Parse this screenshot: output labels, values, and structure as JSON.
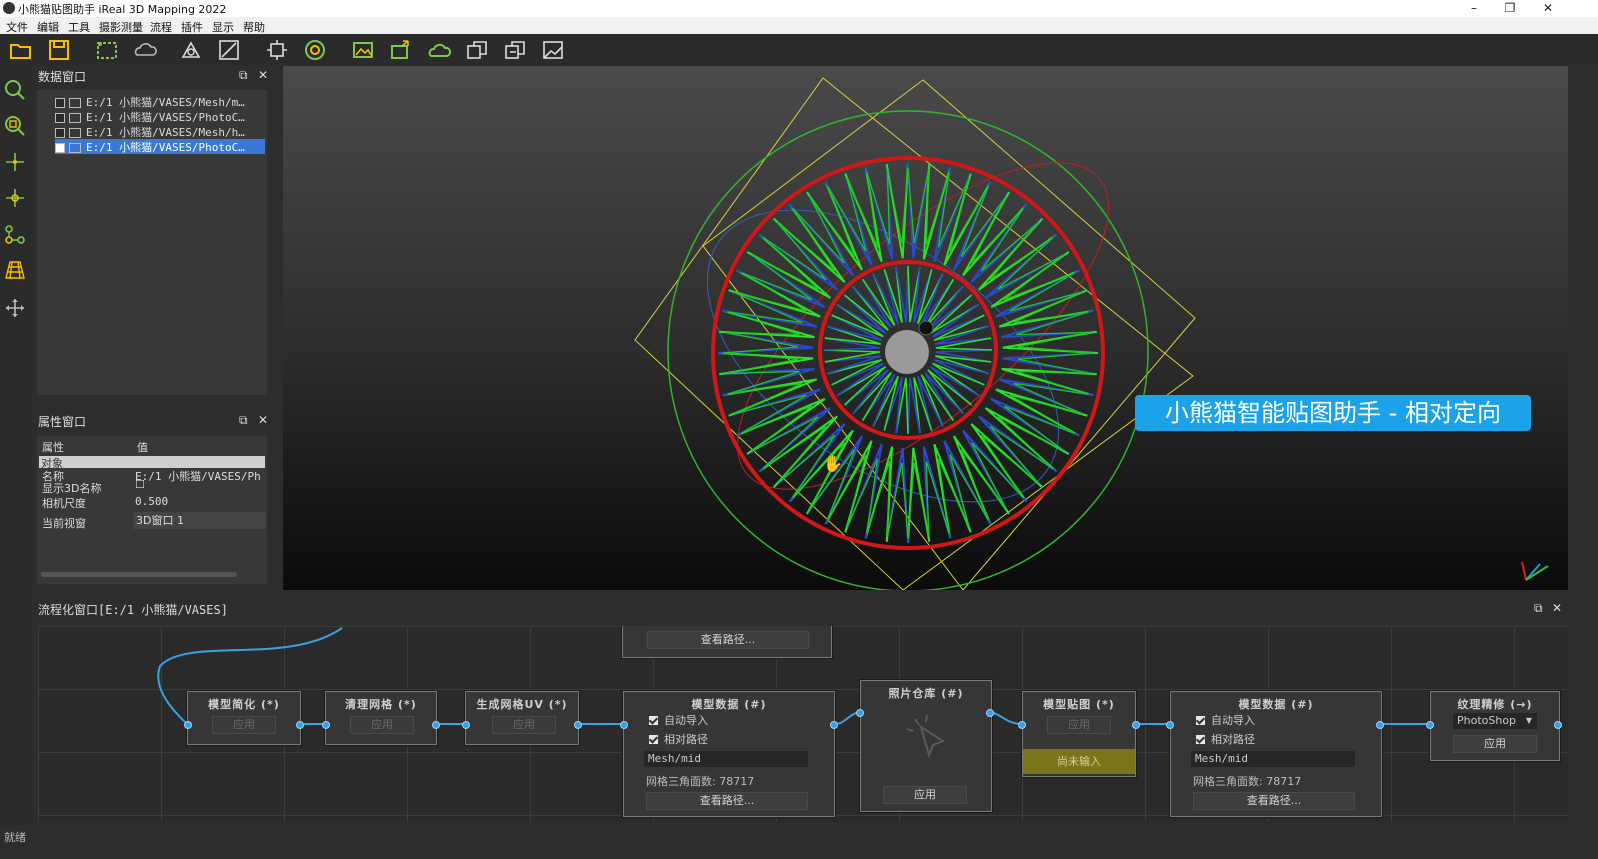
{
  "window": {
    "title": "小熊猫贴图助手 iReal 3D Mapping 2022",
    "minimize": "–",
    "restore": "❐",
    "close": "✕"
  },
  "menu": [
    "文件",
    "编辑",
    "工具",
    "摄影测量",
    "流程",
    "插件",
    "显示",
    "帮助"
  ],
  "toolbar_icons": [
    "open-folder-icon",
    "save-icon",
    "select-region-icon",
    "sdr-cloud-icon",
    "measure-icon",
    "edit-mesh-icon",
    "bbox-icon",
    "target-icon",
    "photo-align-icon",
    "camera-export-icon",
    "cloud-icon",
    "texture-a-icon",
    "texture-b-icon",
    "view-icon"
  ],
  "data_panel": {
    "title": "数据窗口",
    "float": "⧉",
    "close": "✕",
    "items": [
      {
        "label": "E:/1 小熊猫/VASES/Mesh/m…",
        "checked": false,
        "type": "mesh"
      },
      {
        "label": "E:/1 小熊猫/VASES/PhotoC…",
        "checked": false,
        "type": "folder"
      },
      {
        "label": "E:/1 小熊猫/VASES/Mesh/h…",
        "checked": false,
        "type": "mesh"
      },
      {
        "label": "E:/1 小熊猫/VASES/PhotoC…",
        "checked": true,
        "type": "folder",
        "selected": true
      }
    ]
  },
  "prop_panel": {
    "title": "属性窗口",
    "float": "⧉",
    "close": "✕",
    "col_attr": "属性",
    "col_value": "值",
    "section": "对象",
    "rows": [
      {
        "label": "名称",
        "value": "E:/1 小熊猫/VASES/Ph"
      },
      {
        "label": "显示3D名称",
        "value": "☐"
      },
      {
        "label": "相机尺度",
        "value": "0.500"
      },
      {
        "label": "当前视窗",
        "value": "3D窗口 1"
      }
    ]
  },
  "viewport": {
    "banner": "小熊猫智能贴图助手 - 相对定向"
  },
  "flow": {
    "title": "流程化窗口[E:/1 小熊猫/VASES]",
    "float": "⧉",
    "close": "✕",
    "top_node_button": "查看路径...",
    "nodes": {
      "simplify": {
        "title": "模型简化 (*)",
        "button": "应用"
      },
      "clean": {
        "title": "清理网格 (*)",
        "button": "应用"
      },
      "uv": {
        "title": "生成网格UV (*)",
        "button": "应用"
      },
      "model1": {
        "title": "模型数据 (#)",
        "check1": "自动导入",
        "check2": "相对路径",
        "field": "Mesh/mid",
        "info": "网格三角面数: 78717",
        "button": "查看路径..."
      },
      "photos": {
        "title": "照片仓库 (#)",
        "button": "应用"
      },
      "texture": {
        "title": "模型贴图 (*)",
        "button": "应用",
        "status": "尚未输入"
      },
      "model2": {
        "title": "模型数据 (#)",
        "check1": "自动导入",
        "check2": "相对路径",
        "field": "Mesh/mid",
        "info": "网格三角面数: 78717",
        "button": "查看路径..."
      },
      "refine": {
        "title": "纹理精修 (→)",
        "select": "PhotoShop",
        "button": "应用"
      }
    }
  },
  "status": "就绪"
}
